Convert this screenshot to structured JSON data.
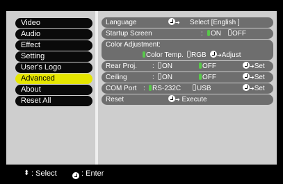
{
  "menu": {
    "items": [
      {
        "label": "Video"
      },
      {
        "label": "Audio"
      },
      {
        "label": "Effect"
      },
      {
        "label": "Setting"
      },
      {
        "label": "User's Logo"
      },
      {
        "label": "Advanced"
      },
      {
        "label": "About"
      },
      {
        "label": "Reset All"
      }
    ],
    "selected": "Advanced"
  },
  "settings": {
    "language": {
      "label": "Language",
      "action": "Select [English  ]"
    },
    "startup_screen": {
      "label": "Startup Screen",
      "sep": ":",
      "on": "ON",
      "off": "OFF",
      "selected": "ON"
    },
    "color_adjustment": {
      "label": "Color Adjustment:",
      "opt1": "Color Temp.",
      "opt2": "RGB",
      "action": "Adjust",
      "selected": "Color Temp."
    },
    "rear_proj": {
      "label": "Rear Proj.",
      "sep": ":",
      "on": "ON",
      "off": "OFF",
      "action": "Set",
      "selected": "OFF"
    },
    "ceiling": {
      "label": "Ceiling",
      "sep": ":",
      "on": "ON",
      "off": "OFF",
      "action": "Set",
      "selected": "OFF"
    },
    "com_port": {
      "label": "COM Port",
      "sep": ":",
      "opt1": "RS-232C",
      "opt2": "USB",
      "action": "Set",
      "selected": "RS-232C"
    },
    "reset": {
      "label": "Reset",
      "action": "Execute"
    }
  },
  "status_bar": {
    "select_icon": "⬍",
    "select_label": ": Select",
    "enter_label": ": Enter"
  },
  "colors": {
    "panel": "#cecece",
    "menu_item": "#0a0a0a",
    "menu_selected": "#e6e600",
    "row": "#6e6e6e",
    "indicator_selected": "#58c84a"
  },
  "icons": {
    "enter": "enter-icon",
    "select": "up-down-arrows-icon",
    "arrow": "right-arrow-icon"
  }
}
